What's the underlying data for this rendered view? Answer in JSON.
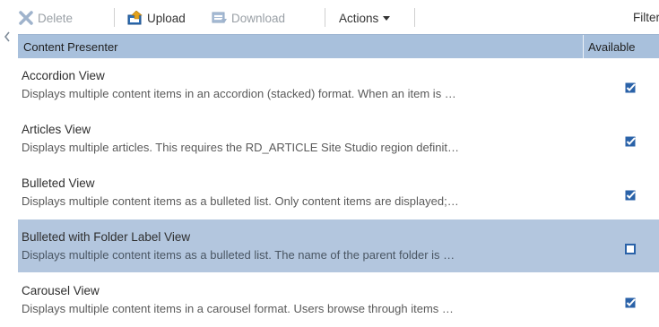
{
  "toolbar": {
    "delete_label": "Delete",
    "upload_label": "Upload",
    "download_label": "Download",
    "actions_label": "Actions",
    "filter_label": "Filter",
    "icons": {
      "delete": "x-icon",
      "upload": "upload-icon",
      "download": "download-icon",
      "actions_menu": "chevron-down-icon"
    }
  },
  "table": {
    "columns": {
      "name": "Content Presenter",
      "available": "Available"
    },
    "rows": [
      {
        "title": "Accordion View",
        "description": "Displays multiple content items in an accordion (stacked) format. When an item is …",
        "available": true
      },
      {
        "title": "Articles View",
        "description": "Displays multiple articles. This requires the RD_ARTICLE Site Studio region definit…",
        "available": true
      },
      {
        "title": "Bulleted View",
        "description": "Displays multiple content items as a bulleted list. Only content items are displayed;…",
        "available": true
      },
      {
        "title": "Bulleted with Folder Label View",
        "description": "Displays multiple content items as a bulleted list. The name of the parent folder is …",
        "available": false,
        "selected": true
      },
      {
        "title": "Carousel View",
        "description": "Displays multiple content items in a carousel format. Users browse through items …",
        "available": true
      }
    ]
  },
  "colors": {
    "header_bg": "#a8c0dc",
    "selected_row_bg": "#b3c6de",
    "checkbox_blue": "#2a62a8",
    "disabled_text": "#9aa0a6"
  }
}
